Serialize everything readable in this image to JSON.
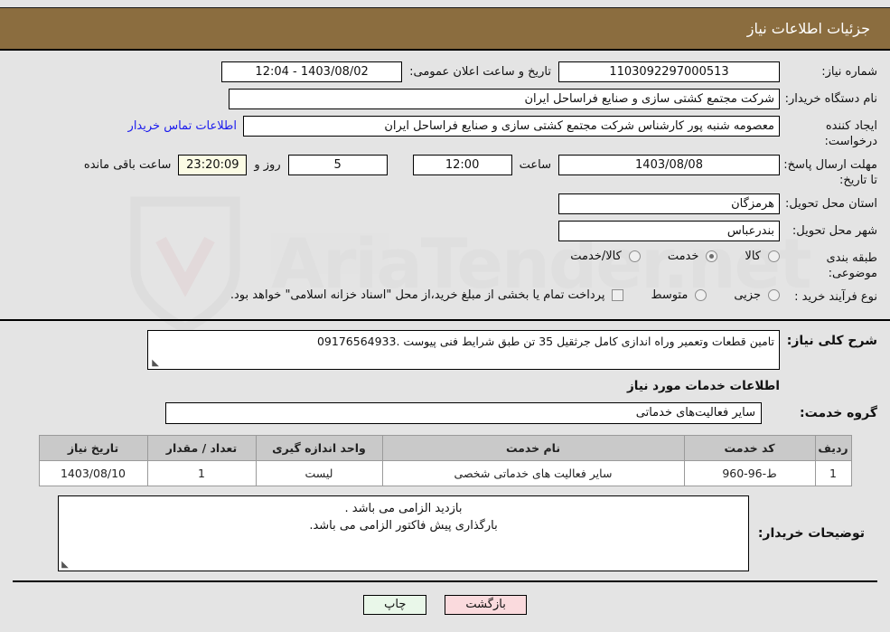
{
  "header": {
    "title": "جزئیات اطلاعات نیاز"
  },
  "form": {
    "need_number_label": "شماره نیاز:",
    "need_number_value": "1103092297000513",
    "public_announce_label": "تاریخ و ساعت اعلان عمومی:",
    "public_announce_value": "1403/08/02 - 12:04",
    "buyer_org_label": "نام دستگاه خریدار:",
    "buyer_org_value": "شرکت مجتمع کشتی سازی و صنایع فراساحل ایران",
    "requester_label": "ایجاد کننده درخواست:",
    "requester_value": "معصومه شنبه پور کارشناس شرکت مجتمع کشتی سازی و صنایع فراساحل ایران",
    "buyer_contact_link": "اطلاعات تماس خریدار",
    "deadline_label": "مهلت ارسال پاسخ: تا تاریخ:",
    "deadline_date": "1403/08/08",
    "hour_label": "ساعت",
    "hour_value": "12:00",
    "days_value": "5",
    "days_label": "روز و",
    "countdown_value": "23:20:09",
    "remaining_label": "ساعت باقی مانده",
    "province_label": "استان محل تحویل:",
    "province_value": "هرمزگان",
    "city_label": "شهر محل تحویل:",
    "city_value": "بندرعباس",
    "category_label": "طبقه بندی موضوعی:",
    "category_options": [
      {
        "label": "کالا",
        "checked": false
      },
      {
        "label": "خدمت",
        "checked": true
      },
      {
        "label": "کالا/خدمت",
        "checked": false
      }
    ],
    "process_label": "نوع فرآیند خرید :",
    "process_options": [
      {
        "label": "جزیی",
        "checked": false
      },
      {
        "label": "متوسط",
        "checked": false
      }
    ],
    "treasury_checkbox_text": "پرداخت تمام یا بخشی از مبلغ خرید،از محل \"اسناد خزانه اسلامی\" خواهد بود.",
    "treasury_checked": false
  },
  "description": {
    "label": "شرح کلی نیاز:",
    "value": "تامین قطعات وتعمیر وراه اندازی کامل جرثقیل 35 تن طبق شرایط فنی پیوست .09176564933"
  },
  "services": {
    "section_title": "اطلاعات خدمات مورد نیاز",
    "group_label": "گروه خدمت:",
    "group_value": "سایر فعالیت‌های خدماتی",
    "table": {
      "headers": [
        "ردیف",
        "کد خدمت",
        "نام خدمت",
        "واحد اندازه گیری",
        "تعداد / مقدار",
        "تاریخ نیاز"
      ],
      "rows": [
        {
          "index": "1",
          "code": "ط-96-960",
          "name": "سایر فعالیت های خدماتی شخصی",
          "unit": "لیست",
          "quantity": "1",
          "need_date": "1403/08/10"
        }
      ]
    }
  },
  "notes": {
    "label": "توضیحات خریدار:",
    "line1": "بازدید الزامی می باشد .",
    "line2": "بارگذاری پیش فاکتور الزامی می باشد."
  },
  "buttons": {
    "print": "چاپ",
    "back": "بازگشت"
  },
  "colors": {
    "header_bg": "#8b6d3f",
    "link": "#1a1aee",
    "print_btn": "#e9f7e9",
    "back_btn": "#fadadd",
    "table_header": "#c9c9c9",
    "page_bg": "#e4e4e4"
  }
}
